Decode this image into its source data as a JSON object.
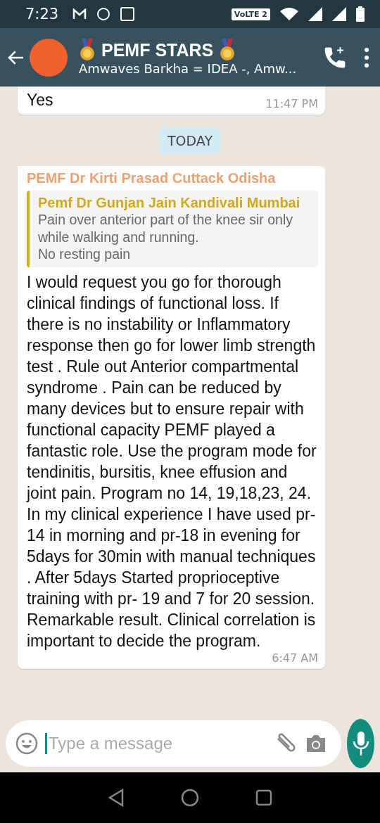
{
  "status_bar": {
    "time": "7:23",
    "network_badge": "VoLTE 2"
  },
  "header": {
    "title": "PEMF STARS",
    "subtitle": "Amwaves Barkha = IDEA -, Amw..."
  },
  "messages": [
    {
      "kind": "text",
      "text": "Yes",
      "time": "11:47 PM"
    },
    {
      "kind": "date",
      "text": "TODAY"
    },
    {
      "kind": "reply",
      "sender": "PEMF Dr Kirti Prasad Cuttack Odisha",
      "quote": {
        "author": "Pemf Dr Gunjan Jain Kandivali Mumbai",
        "text": "Pain over anterior part of the knee sir only while walking and running.\nNo resting pain"
      },
      "text": "I would request you go for thorough clinical findings of functional loss. If there is no instability or Inflammatory response then go for lower limb strength test . Rule out Anterior compartmental syndrome . Pain can be reduced by many devices but to ensure repair with functional capacity PEMF played a fantastic role. Use the program mode for tendinitis, bursitis, knee effusion and joint pain. Program no 14, 19,18,23, 24. In my clinical experience I have used pr-14 in morning and pr-18 in evening for 5days for 30min with manual techniques . After 5days  Started proprioceptive training with  pr- 19 and 7 for 20 session. Remarkable result. Clinical correlation is important to decide the program.",
      "time": "6:47 AM"
    }
  ],
  "composer": {
    "placeholder": "Type a message"
  }
}
